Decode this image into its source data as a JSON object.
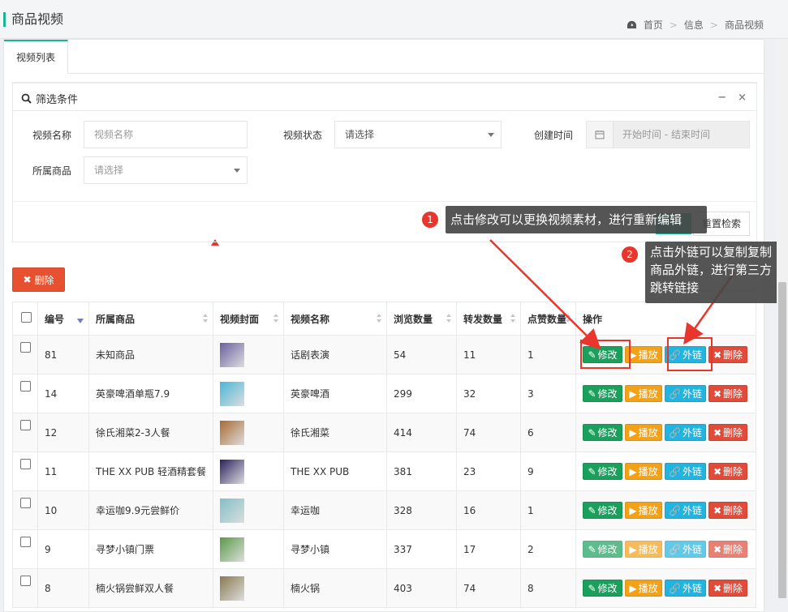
{
  "header": {
    "title": "商品视频"
  },
  "breadcrumb": {
    "home": "首页",
    "level2": "信息",
    "current": "商品视频",
    "sep": ">"
  },
  "tabs": [
    {
      "label": "视频列表"
    }
  ],
  "filter": {
    "title": "筛选条件",
    "collapse": "−",
    "close": "×",
    "name_label": "视频名称",
    "name_placeholder": "视频名称",
    "status_label": "视频状态",
    "status_value": "请选择",
    "created_label": "创建时间",
    "created_placeholder": "开始时间 - 结束时间",
    "product_label": "所属商品",
    "product_value": "请选择",
    "reset_label": "重置检索"
  },
  "toolbar": {
    "delete_label": "删除"
  },
  "table": {
    "headers": [
      "编号",
      "所属商品",
      "视频封面",
      "视频名称",
      "浏览数量",
      "转发数量",
      "点赞数量",
      "操作"
    ],
    "actions": {
      "edit": "修改",
      "play": "播放",
      "link": "外链",
      "delete": "删除"
    },
    "rows": [
      {
        "id": "81",
        "product": "未知商品",
        "name": "话剧表演",
        "views": "54",
        "shares": "11",
        "likes": "1",
        "thumb": "#6a5fa0"
      },
      {
        "id": "14",
        "product": "英豪啤酒单瓶7.9",
        "name": "英豪啤酒",
        "views": "299",
        "shares": "32",
        "likes": "3",
        "thumb": "#48b7d8"
      },
      {
        "id": "12",
        "product": "徐氏湘菜2-3人餐",
        "name": "徐氏湘菜",
        "views": "414",
        "shares": "74",
        "likes": "6",
        "thumb": "#a86a30"
      },
      {
        "id": "11",
        "product": "THE XX PUB 轻酒精套餐",
        "name": "THE XX PUB",
        "views": "381",
        "shares": "23",
        "likes": "9",
        "thumb": "#2a2060"
      },
      {
        "id": "10",
        "product": "幸运咖9.9元尝鲜价",
        "name": "幸运咖",
        "views": "328",
        "shares": "16",
        "likes": "1",
        "thumb": "#7fc0c8"
      },
      {
        "id": "9",
        "product": "寻梦小镇门票",
        "name": "寻梦小镇",
        "views": "337",
        "shares": "17",
        "likes": "2",
        "thumb": "#5a9a48"
      },
      {
        "id": "8",
        "product": "楠火锅尝鲜双人餐",
        "name": "楠火锅",
        "views": "403",
        "shares": "74",
        "likes": "8",
        "thumb": "#8a7a50"
      }
    ]
  },
  "tips": [
    {
      "num": "1",
      "text": "点击修改可以更换视频素材，进行重新编辑"
    },
    {
      "num": "2",
      "line1": "点击外链可以复制复制",
      "line2": "商品外链，进行第三方",
      "line3": "跳转链接"
    }
  ],
  "colors": {
    "accent": "#1ab394",
    "annotation": "#e8362d",
    "edit": "#1aa05c",
    "play": "#f3a116",
    "link": "#1fb5e0",
    "delete": "#e04b3a"
  }
}
